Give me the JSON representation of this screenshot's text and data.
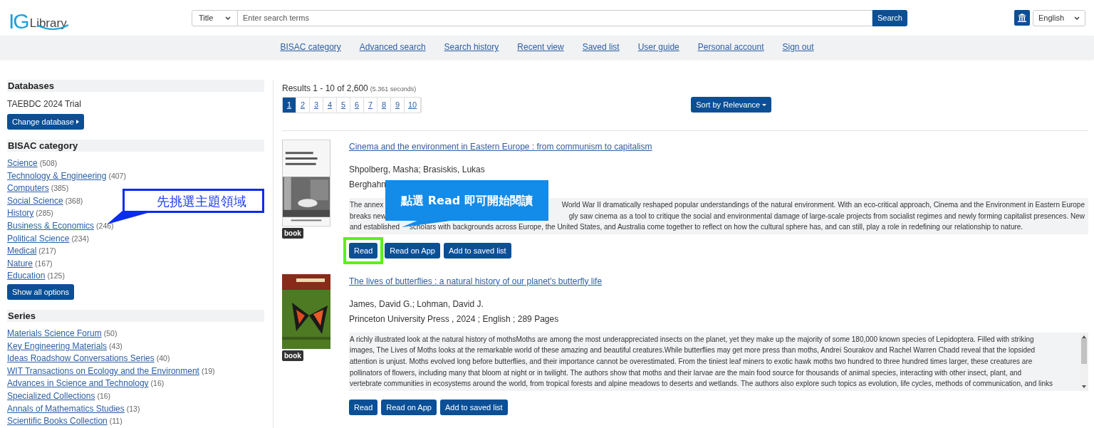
{
  "logo": {
    "mark": "IG",
    "word": "Library"
  },
  "search": {
    "field": "Title",
    "placeholder": "Enter search terms",
    "button": "Search"
  },
  "language": "English",
  "nav": [
    "BISAC category",
    "Advanced search",
    "Search history",
    "Recent view",
    "Saved list",
    "User guide",
    "Personal account",
    "Sign out"
  ],
  "sidebar": [
    {
      "kind": "database",
      "title": "Databases",
      "text": "TAEBDC 2024 Trial",
      "button": "Change database"
    },
    {
      "kind": "facet",
      "title": "BISAC category",
      "items": [
        {
          "label": "Science",
          "count": "(508)"
        },
        {
          "label": "Technology & Engineering",
          "count": "(407)"
        },
        {
          "label": "Computers",
          "count": "(385)"
        },
        {
          "label": "Social Science",
          "count": "(368)"
        },
        {
          "label": "History",
          "count": "(285)"
        },
        {
          "label": "Business & Economics",
          "count": "(246)"
        },
        {
          "label": "Political Science",
          "count": "(234)"
        },
        {
          "label": "Medical",
          "count": "(217)"
        },
        {
          "label": "Nature",
          "count": "(167)"
        },
        {
          "label": "Education",
          "count": "(125)"
        }
      ],
      "button": "Show all options"
    },
    {
      "kind": "facet",
      "title": "Series",
      "items": [
        {
          "label": "Materials Science Forum",
          "count": "(50)"
        },
        {
          "label": "Key Engineering Materials",
          "count": "(43)"
        },
        {
          "label": "Ideas Roadshow Conversations Series",
          "count": "(40)"
        },
        {
          "label": "WIT Transactions on Ecology and the Environment",
          "count": "(19)"
        },
        {
          "label": "Advances in Science and Technology",
          "count": "(16)"
        },
        {
          "label": "Specialized Collections",
          "count": "(16)"
        },
        {
          "label": "Annals of Mathematics Studies",
          "count": "(13)"
        },
        {
          "label": "Scientific Books Collection",
          "count": "(11)"
        }
      ]
    }
  ],
  "results": {
    "summary": "Results 1 - 10 of 2,600",
    "time": "(5.361 seconds)",
    "pages": [
      {
        "label": "1",
        "selected": true
      },
      {
        "label": "2",
        "selected": false
      },
      {
        "label": "3",
        "selected": false
      },
      {
        "label": "4",
        "selected": false
      },
      {
        "label": "5",
        "selected": false
      },
      {
        "label": "6",
        "selected": false
      },
      {
        "label": "7",
        "selected": false
      },
      {
        "label": "8",
        "selected": false
      },
      {
        "label": "9",
        "selected": false
      },
      {
        "label": "10",
        "selected": false
      }
    ],
    "sort": "Sort by Relevance",
    "items": [
      {
        "title": "Cinema and the environment in Eastern Europe : from communism to capitalism",
        "authors": "Shpolberg, Masha; Brasiskis, Lukas",
        "publisher": "Berghahn",
        "tag": "book",
        "description": [
          [
            "The annex",
            "World War II dramatically reshaped popular understandings of the natural environment. With an eco-critical approach, Cinema and the Environment in Eastern Europe"
          ],
          [
            "breaks new",
            "gly saw cinema as a tool to critique the social and environmental damage of large-scale projects from socialist regimes and newly forming capitalist presences. New"
          ],
          [
            "and established",
            "scholars with backgrounds across Europe, the United States, and Australia come together to reflect on how the cultural sphere has, and can still, play a role in redefining our relationship to nature."
          ]
        ],
        "scrollable": false,
        "buttons": [
          "Read",
          "Read on App",
          "Add to saved list"
        ]
      },
      {
        "title": "The lives of butterflies : a natural history of our planet's butterfly life",
        "authors": "James, David G.; Lohman, David J.",
        "publisher": "Princeton University Press , 2024 ; English ; 289 Pages",
        "tag": "book",
        "description": [
          [
            "A richly illustrated look at the natural history of mothsMoths are among the most underappreciated insects on the planet, yet they make up the majority of some 180,000 known species of Lepidoptera. Filled with striking"
          ],
          [
            "images, The Lives of Moths looks at the remarkable world of these amazing and beautiful creatures.While butterflies may get more press than moths, Andrei Sourakov and Rachel Warren Chadd reveal that the lopsided"
          ],
          [
            "attention is unjust. Moths evolved long before butterflies, and their importance cannot be overestimated. From the tiniest leaf miners to exotic hawk moths two hundred to three hundred times larger, these creatures are"
          ],
          [
            "pollinators of flowers, including many that bloom at night or in twilight. The authors show that moths and their larvae are the main food source for thousands of animal species, interacting with other insect, plant, and"
          ],
          [
            "vertebrate communities in ecosystems around the world, from tropical forests and alpine meadows to deserts and wetlands. The authors also explore such topics as evolution, life cycles, methods of communication, and links"
          ]
        ],
        "scrollable": true,
        "buttons": [
          "Read",
          "Read on App",
          "Add to saved list"
        ]
      }
    ]
  },
  "annotations": [
    {
      "kind": "tag",
      "text": "先挑選主題領域"
    },
    {
      "kind": "bubble",
      "text": "點選 Read 即可開始閱讀"
    },
    {
      "kind": "highlight"
    }
  ]
}
